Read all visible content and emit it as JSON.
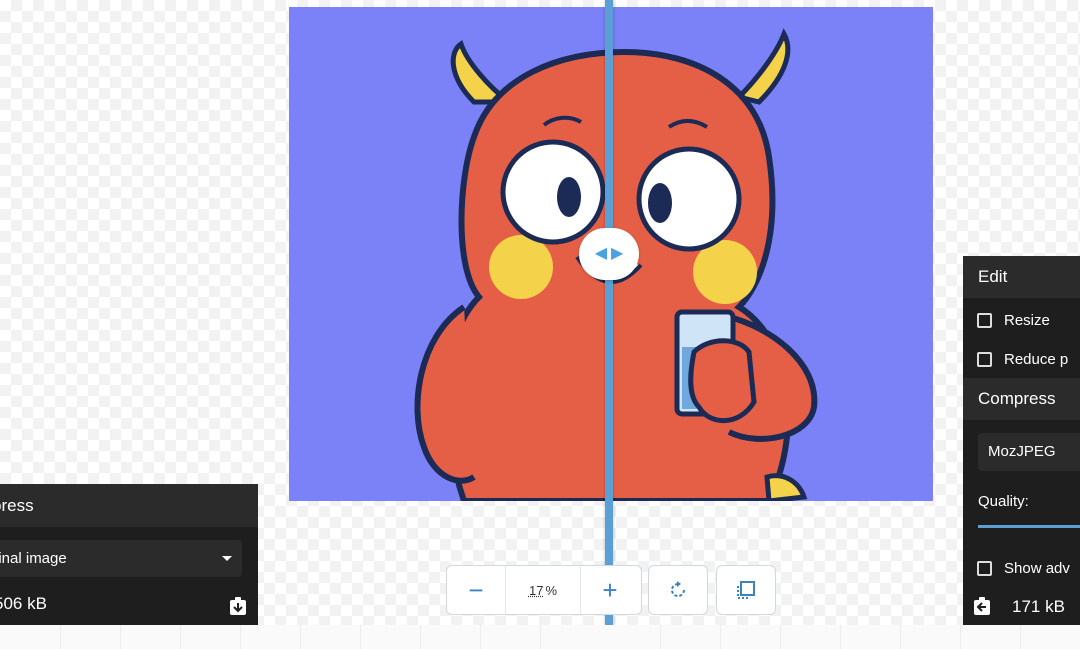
{
  "zoom": {
    "minus_label": "−",
    "value": "17",
    "unit": "%",
    "plus_label": "+"
  },
  "icons": {
    "rotate": "rotate-icon",
    "fit": "fit-to-screen-icon",
    "download": "download-icon",
    "upload": "upload-icon",
    "divider": "divider-handle-icon"
  },
  "left_panel": {
    "title": "press",
    "method": "ginal image",
    "size": "506 kB"
  },
  "right_panel": {
    "edit_title": "Edit",
    "resize_label": "Resize",
    "reduce_label": "Reduce p",
    "compress_title": "Compress",
    "codec": "MozJPEG",
    "quality_label": "Quality:",
    "advanced_label": "Show adv",
    "size": "171 kB"
  },
  "colors": {
    "accent": "#5aa0d6",
    "panel": "#1e1e1e",
    "panel_header": "#2b2b2b",
    "image_bg": "#7b81f7",
    "monster": "#e55f46"
  }
}
